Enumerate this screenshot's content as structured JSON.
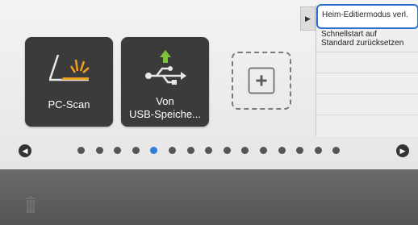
{
  "home": {
    "tiles": [
      {
        "label_lines": [
          "PC-Scan"
        ],
        "icon": "scanner-icon"
      },
      {
        "label_lines": [
          "Von",
          "USB-Speiche..."
        ],
        "icon": "usb-upload-icon"
      }
    ],
    "add_tile_icon": "plus-icon",
    "pager": {
      "page_count": 15,
      "active_index": 4
    }
  },
  "menu": {
    "tab_icon": "triangle-right",
    "items": [
      {
        "label": "Heim-Editiermodus verl.",
        "selected": true
      },
      {
        "label": "Schnellstart auf Standard zurücksetzen",
        "line1": "Schnellstart auf",
        "line2": "Standard zurücksetzen"
      }
    ]
  },
  "colors": {
    "accent": "#2b6fd0",
    "tile_bg": "#3b3b3b",
    "active_dot": "#2d7fd6"
  }
}
